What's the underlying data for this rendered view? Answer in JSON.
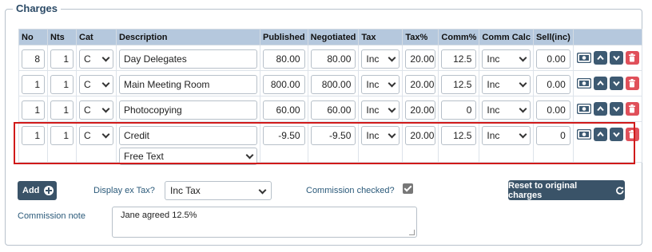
{
  "section": {
    "legend": "Charges"
  },
  "columns": [
    "No",
    "Nts",
    "Cat",
    "Description",
    "Published",
    "Negotiated",
    "Tax",
    "Tax%",
    "Comm%",
    "Comm Calc",
    "Sell(inc)"
  ],
  "rows": [
    {
      "no": "8",
      "nts": "1",
      "cat": "C",
      "description": "Day Delegates",
      "published": "80.00",
      "negotiated": "80.00",
      "tax": "Inc",
      "tax_pct": "20.00",
      "comm_pct": "12.5",
      "comm_calc": "Inc",
      "sell": "0.00"
    },
    {
      "no": "1",
      "nts": "1",
      "cat": "C",
      "description": "Main Meeting Room",
      "published": "800.00",
      "negotiated": "800.00",
      "tax": "Inc",
      "tax_pct": "20.00",
      "comm_pct": "12.5",
      "comm_calc": "Inc",
      "sell": "0.00"
    },
    {
      "no": "1",
      "nts": "1",
      "cat": "C",
      "description": "Photocopying",
      "published": "60.00",
      "negotiated": "60.00",
      "tax": "Inc",
      "tax_pct": "20.00",
      "comm_pct": "0",
      "comm_calc": "Inc",
      "sell": "0.00"
    },
    {
      "no": "1",
      "nts": "1",
      "cat": "C",
      "description": "Credit",
      "description_type": "Free Text",
      "published": "-9.50",
      "negotiated": "-9.50",
      "tax": "Inc",
      "tax_pct": "20.00",
      "comm_pct": "12.5",
      "comm_calc": "Inc",
      "sell": "0"
    }
  ],
  "row_action_icons": [
    "money-icon",
    "arrow-up-icon",
    "arrow-down-icon",
    "trash-icon"
  ],
  "controls": {
    "add_label": "Add",
    "display_ex_tax_label": "Display ex Tax?",
    "display_ex_tax_value": "Inc Tax",
    "commission_checked_label": "Commission checked?",
    "commission_checked": true,
    "reset_label": "Reset to original charges",
    "commission_note_label": "Commission note",
    "commission_note_value": "Jane agreed 12.5%"
  },
  "colors": {
    "header_bg": "#b5c8dd",
    "button_dark": "#3a5368",
    "delete_red": "#e0505a",
    "highlight_red": "#d01a1a"
  }
}
